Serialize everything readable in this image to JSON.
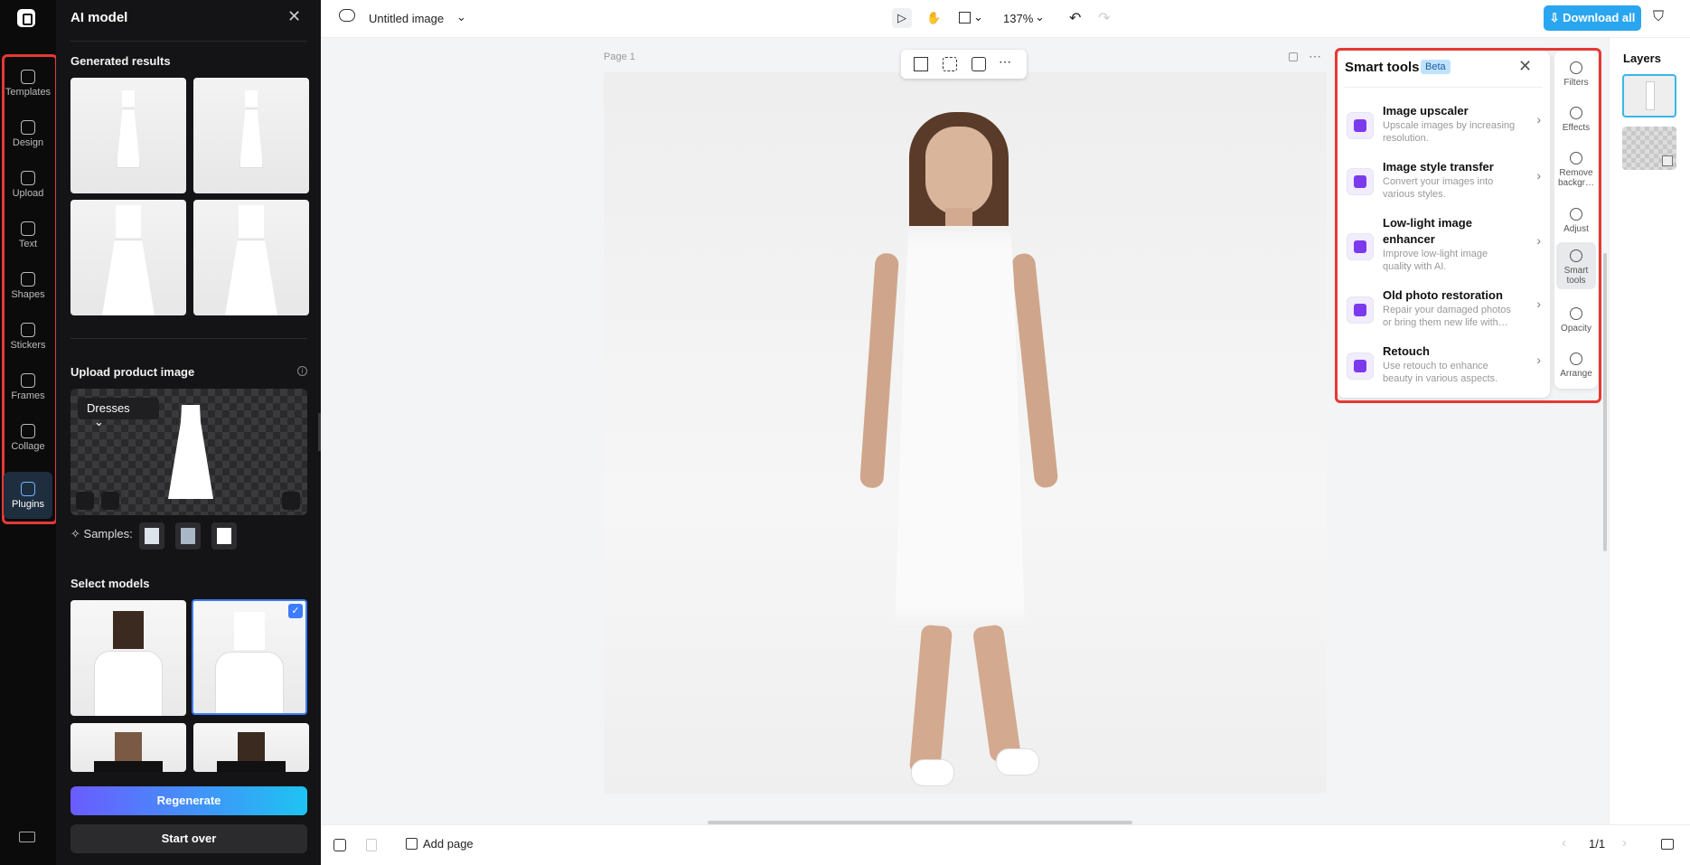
{
  "rail": {
    "items": [
      {
        "label": "Templates",
        "icon": "templates-icon"
      },
      {
        "label": "Design",
        "icon": "design-icon"
      },
      {
        "label": "Upload",
        "icon": "upload-icon"
      },
      {
        "label": "Text",
        "icon": "text-icon"
      },
      {
        "label": "Shapes",
        "icon": "shapes-icon"
      },
      {
        "label": "Stickers",
        "icon": "stickers-icon"
      },
      {
        "label": "Frames",
        "icon": "frames-icon"
      },
      {
        "label": "Collage",
        "icon": "collage-icon"
      },
      {
        "label": "Plugins",
        "icon": "plugins-icon",
        "active": true
      }
    ]
  },
  "panel": {
    "title": "AI model",
    "generated_title": "Generated results",
    "upload_title": "Upload product image",
    "category": "Dresses",
    "samples_label": "Samples:",
    "models_title": "Select models",
    "regenerate": "Regenerate",
    "start_over": "Start over"
  },
  "topbar": {
    "title": "Untitled image",
    "zoom": "137%",
    "download": "Download all"
  },
  "canvas": {
    "page_label": "Page 1"
  },
  "smart_tools": {
    "title": "Smart tools",
    "badge": "Beta",
    "tools": [
      {
        "name": "Image upscaler",
        "desc": "Upscale images by increasing resolution."
      },
      {
        "name": "Image style transfer",
        "desc": "Convert your images into various styles."
      },
      {
        "name": "Low-light image enhancer",
        "desc": "Improve low-light image quality with AI."
      },
      {
        "name": "Old photo restoration",
        "desc": "Repair your damaged photos or bring them new life with…"
      },
      {
        "name": "Retouch",
        "desc": "Use retouch to enhance beauty in various aspects."
      }
    ]
  },
  "side_tools": {
    "items": [
      {
        "label": "Filters"
      },
      {
        "label": "Effects"
      },
      {
        "label": "Remove backgr…"
      },
      {
        "label": "Adjust"
      },
      {
        "label": "Smart tools",
        "active": true
      },
      {
        "label": "Opacity"
      },
      {
        "label": "Arrange"
      }
    ]
  },
  "layers": {
    "title": "Layers"
  },
  "bottom": {
    "add_page": "Add page",
    "page_count": "1/1"
  },
  "colors": {
    "accent": "#2aa6f0",
    "highlight": "#e53935",
    "selected": "#3d7bff"
  }
}
